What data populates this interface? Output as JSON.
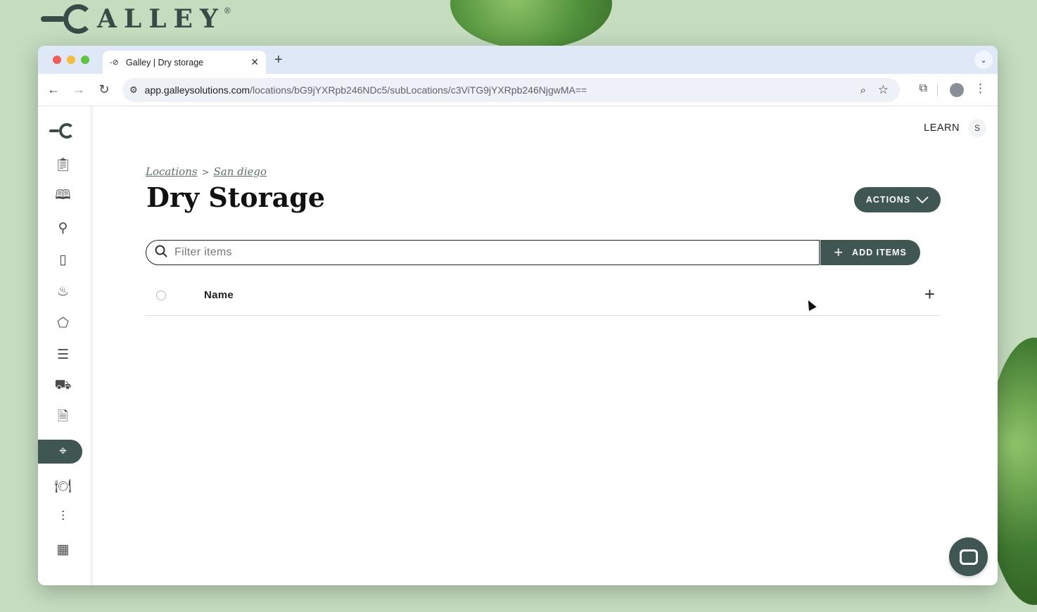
{
  "background_brand": {
    "wordmark": "ALLEY",
    "registered": "®"
  },
  "browser": {
    "tab_title": "Galley | Dry storage",
    "tab_favicon": "-⊘",
    "new_tab": "+",
    "url_host": "app.galleysolutions.com",
    "url_path": "/locations/bG9jYXRpb246NDc5/subLocations/c3ViTG9jYXRpb246NjgwMA=="
  },
  "header": {
    "learn_label": "LEARN",
    "avatar_initial": "S"
  },
  "breadcrumb": {
    "locations": "Locations",
    "separator": ">",
    "parent": "San diego"
  },
  "page": {
    "title": "Dry Storage",
    "actions_label": "ACTIONS"
  },
  "filter": {
    "placeholder": "Filter items"
  },
  "add_items": {
    "label": "ADD ITEMS"
  },
  "table": {
    "columns": [
      "Name"
    ]
  },
  "sidebar": {
    "items": [
      {
        "icon": "clipboard-icon"
      },
      {
        "icon": "recipe-book-icon"
      },
      {
        "icon": "ingredient-icon"
      },
      {
        "icon": "package-icon"
      },
      {
        "icon": "chef-hat-icon"
      },
      {
        "icon": "tag-icon"
      },
      {
        "icon": "checklist-icon"
      },
      {
        "icon": "cart-icon"
      },
      {
        "icon": "document-icon"
      },
      {
        "icon": "location-pin-icon",
        "active": true
      },
      {
        "icon": "dining-icon"
      },
      {
        "icon": "sliders-icon"
      },
      {
        "icon": "calendar-icon"
      }
    ]
  },
  "colors": {
    "accent": "#3f5652",
    "background": "#c5dcbf"
  }
}
